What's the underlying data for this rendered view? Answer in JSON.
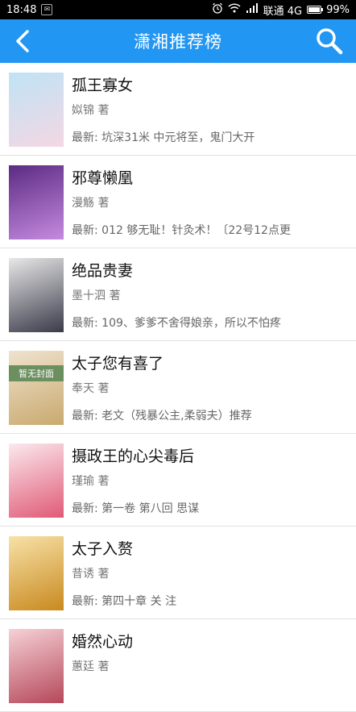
{
  "status": {
    "time": "18:48",
    "carrier": "联通 4G",
    "battery": "99%",
    "battery_level": 0.99
  },
  "appbar": {
    "title": "潇湘推荐榜",
    "back_icon": "back-arrow-icon",
    "search_icon": "search-icon"
  },
  "books": [
    {
      "title": "孤王寡女",
      "author": "姒锦 著",
      "latest": "最新: 坑深31米 中元将至，鬼门大开",
      "cover_colors": [
        "#bfe3f5",
        "#f4d7e3"
      ]
    },
    {
      "title": "邪尊懒凰",
      "author": "漫觞 著",
      "latest": "最新: 012 够无耻！针灸术！〔22号12点更",
      "cover_colors": [
        "#5b2c82",
        "#c58ae0"
      ]
    },
    {
      "title": "绝品贵妻",
      "author": "墨十泗 著",
      "latest": "最新: 109、爹爹不舍得娘亲，所以不怕疼",
      "cover_colors": [
        "#e8e8e8",
        "#3a3a4a"
      ]
    },
    {
      "title": "太子您有喜了",
      "author": "奉天 著",
      "latest": "最新: 老文（残暴公主,柔弱夫）推荐",
      "cover_colors": [
        "#efe3cf",
        "#c9a96e"
      ],
      "cover_text": "暂无封面"
    },
    {
      "title": "摄政王的心尖毒后",
      "author": "瑾瑜 著",
      "latest": "最新: 第一卷 第八回 思谋",
      "cover_colors": [
        "#fbe9ee",
        "#e05a76"
      ]
    },
    {
      "title": "太子入赘",
      "author": "昔诱 著",
      "latest": "最新: 第四十章 关 注",
      "cover_colors": [
        "#f7e2a8",
        "#c9891f"
      ]
    },
    {
      "title": "婚然心动",
      "author": "蕙廷 著",
      "latest": "",
      "cover_colors": [
        "#f6d1d6",
        "#b5485a"
      ]
    }
  ]
}
